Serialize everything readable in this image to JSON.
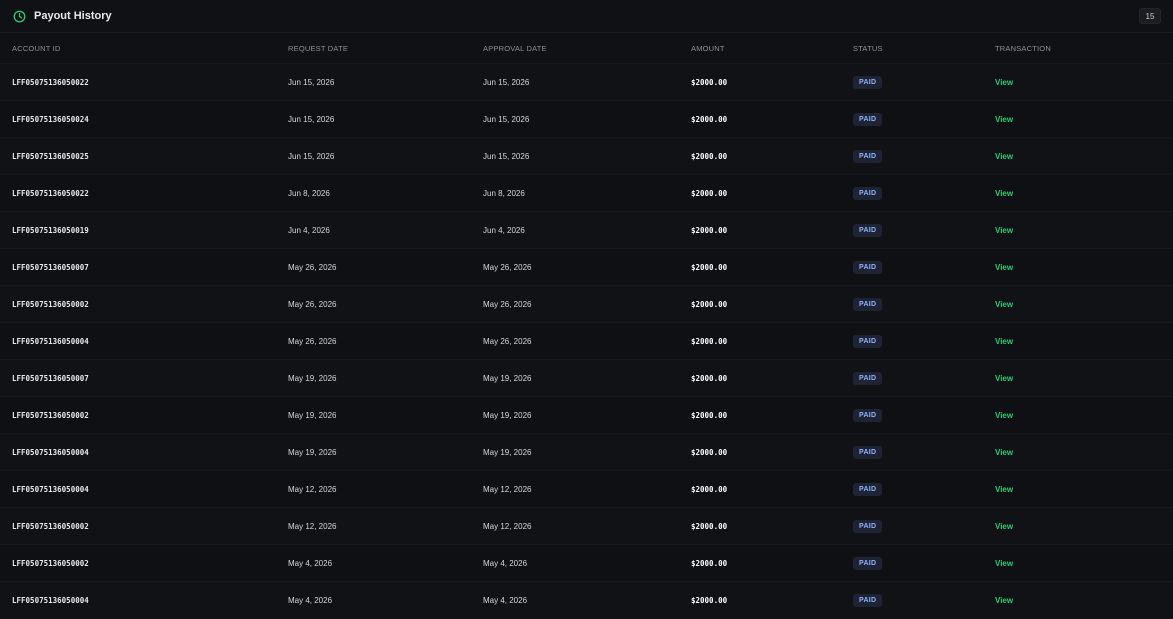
{
  "header": {
    "title": "Payout History",
    "count": "15"
  },
  "colors": {
    "accent": "#2ecc71",
    "badge_bg": "#1e2433",
    "badge_text": "#8fb3ff"
  },
  "table": {
    "columns": [
      "ACCOUNT ID",
      "REQUEST DATE",
      "APPROVAL DATE",
      "AMOUNT",
      "STATUS",
      "TRANSACTION"
    ],
    "rows": [
      {
        "account": "LFF05075136050022",
        "request": "Jun 15, 2026",
        "approval": "Jun 15, 2026",
        "amount": "$2000.00",
        "status": "PAID",
        "action": "View"
      },
      {
        "account": "LFF05075136050024",
        "request": "Jun 15, 2026",
        "approval": "Jun 15, 2026",
        "amount": "$2000.00",
        "status": "PAID",
        "action": "View"
      },
      {
        "account": "LFF05075136050025",
        "request": "Jun 15, 2026",
        "approval": "Jun 15, 2026",
        "amount": "$2000.00",
        "status": "PAID",
        "action": "View"
      },
      {
        "account": "LFF05075136050022",
        "request": "Jun 8, 2026",
        "approval": "Jun 8, 2026",
        "amount": "$2000.00",
        "status": "PAID",
        "action": "View"
      },
      {
        "account": "LFF05075136050019",
        "request": "Jun 4, 2026",
        "approval": "Jun 4, 2026",
        "amount": "$2000.00",
        "status": "PAID",
        "action": "View"
      },
      {
        "account": "LFF05075136050007",
        "request": "May 26, 2026",
        "approval": "May 26, 2026",
        "amount": "$2000.00",
        "status": "PAID",
        "action": "View"
      },
      {
        "account": "LFF05075136050002",
        "request": "May 26, 2026",
        "approval": "May 26, 2026",
        "amount": "$2000.00",
        "status": "PAID",
        "action": "View"
      },
      {
        "account": "LFF05075136050004",
        "request": "May 26, 2026",
        "approval": "May 26, 2026",
        "amount": "$2000.00",
        "status": "PAID",
        "action": "View"
      },
      {
        "account": "LFF05075136050007",
        "request": "May 19, 2026",
        "approval": "May 19, 2026",
        "amount": "$2000.00",
        "status": "PAID",
        "action": "View"
      },
      {
        "account": "LFF05075136050002",
        "request": "May 19, 2026",
        "approval": "May 19, 2026",
        "amount": "$2000.00",
        "status": "PAID",
        "action": "View"
      },
      {
        "account": "LFF05075136050004",
        "request": "May 19, 2026",
        "approval": "May 19, 2026",
        "amount": "$2000.00",
        "status": "PAID",
        "action": "View"
      },
      {
        "account": "LFF05075136050004",
        "request": "May 12, 2026",
        "approval": "May 12, 2026",
        "amount": "$2000.00",
        "status": "PAID",
        "action": "View"
      },
      {
        "account": "LFF05075136050002",
        "request": "May 12, 2026",
        "approval": "May 12, 2026",
        "amount": "$2000.00",
        "status": "PAID",
        "action": "View"
      },
      {
        "account": "LFF05075136050002",
        "request": "May 4, 2026",
        "approval": "May 4, 2026",
        "amount": "$2000.00",
        "status": "PAID",
        "action": "View"
      },
      {
        "account": "LFF05075136050004",
        "request": "May 4, 2026",
        "approval": "May 4, 2026",
        "amount": "$2000.00",
        "status": "PAID",
        "action": "View"
      }
    ]
  }
}
